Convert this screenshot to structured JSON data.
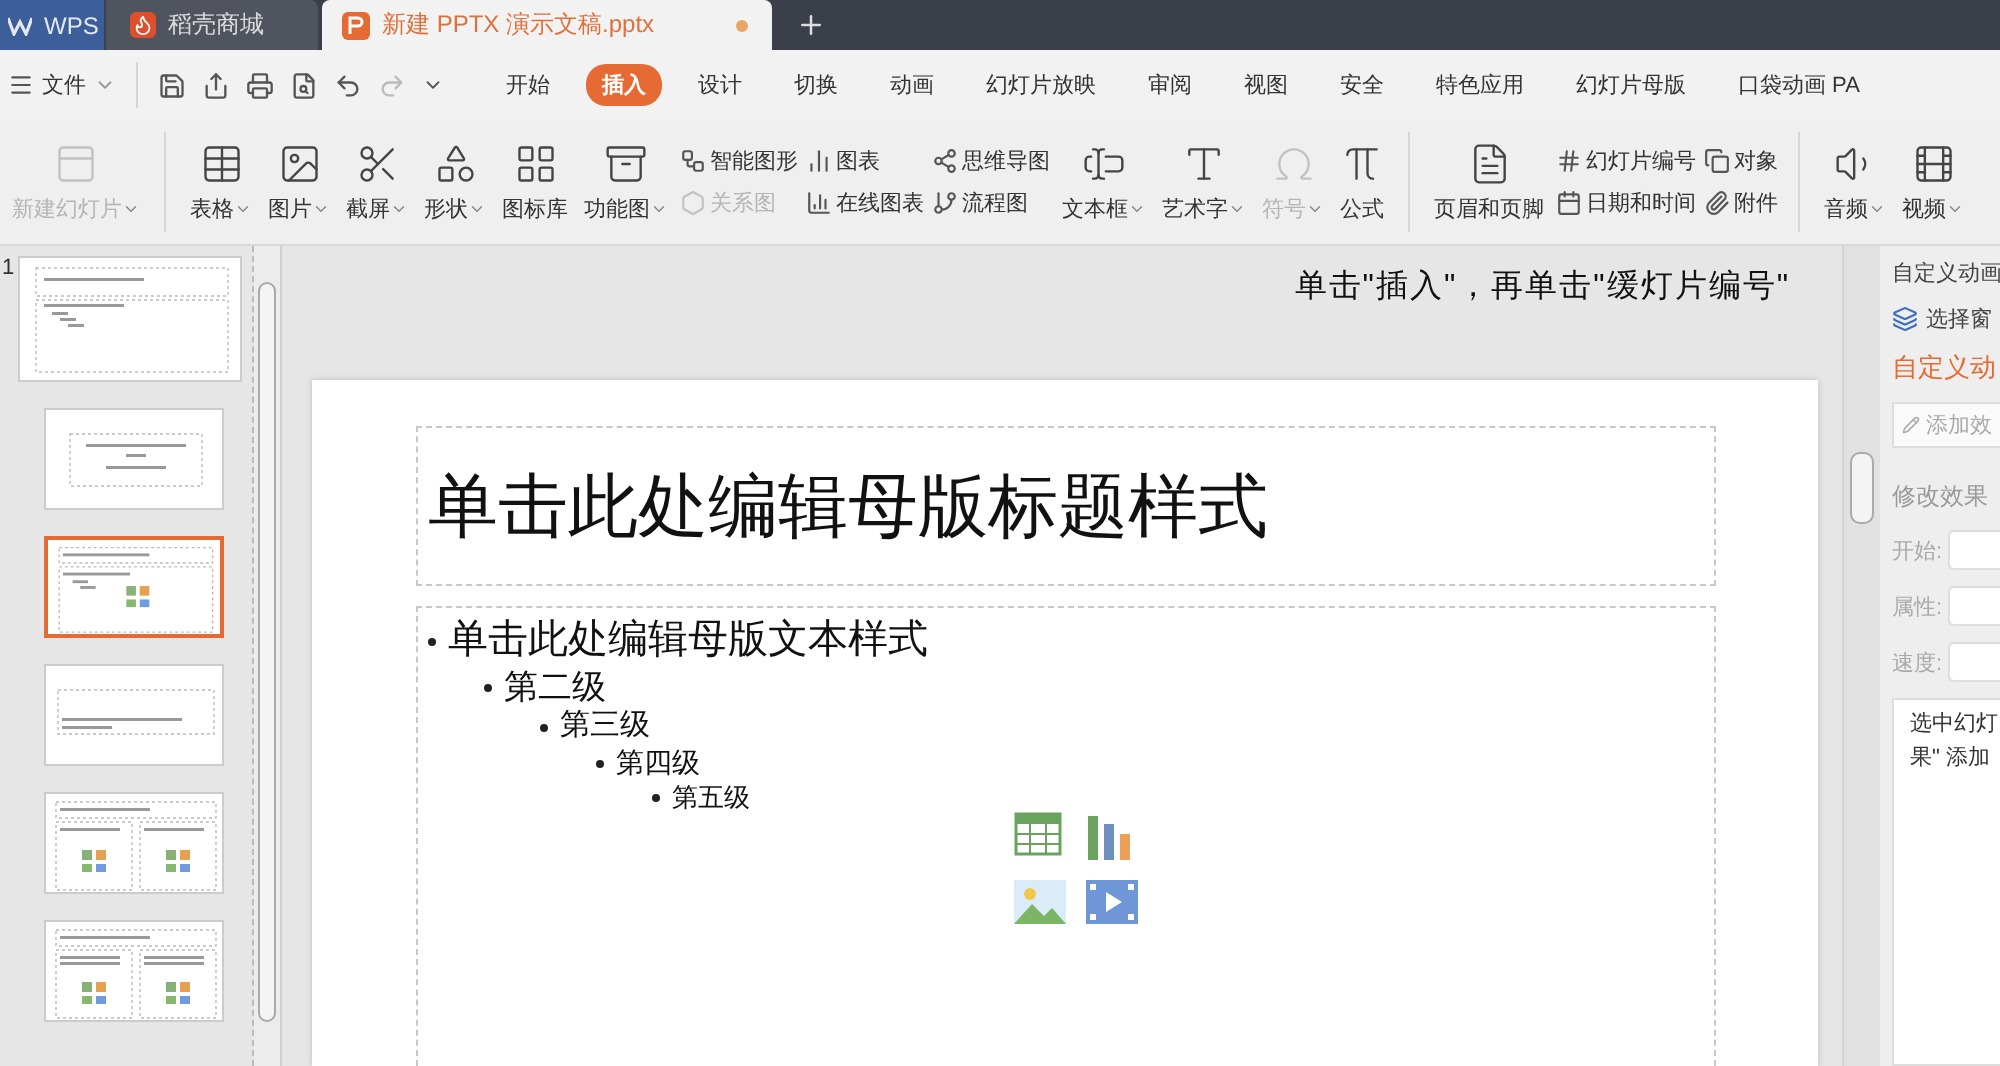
{
  "title_bar": {
    "tabs": [
      {
        "label": "WPS",
        "kind": "home",
        "selected": false
      },
      {
        "label": "稻壳商城",
        "kind": "store",
        "selected": false
      },
      {
        "label": "新建 PPTX 演示文稿.pptx",
        "kind": "doc",
        "selected": true
      }
    ]
  },
  "menu_bar": {
    "file_label": "文件",
    "tabs": [
      {
        "label": "开始",
        "selected": false
      },
      {
        "label": "插入",
        "selected": true
      },
      {
        "label": "设计",
        "selected": false
      },
      {
        "label": "切换",
        "selected": false
      },
      {
        "label": "动画",
        "selected": false
      },
      {
        "label": "幻灯片放映",
        "selected": false
      },
      {
        "label": "审阅",
        "selected": false
      },
      {
        "label": "视图",
        "selected": false
      },
      {
        "label": "安全",
        "selected": false
      },
      {
        "label": "特色应用",
        "selected": false
      },
      {
        "label": "幻灯片母版",
        "selected": false
      },
      {
        "label": "口袋动画 PA",
        "selected": false
      }
    ]
  },
  "ribbon_groups": [
    [
      {
        "kind": "large",
        "label": "新建幻灯片",
        "dropdown": true,
        "disabled": true
      }
    ],
    [
      {
        "kind": "large",
        "label": "表格",
        "dropdown": true,
        "disabled": false
      },
      {
        "kind": "large",
        "label": "图片",
        "dropdown": true,
        "disabled": false
      },
      {
        "kind": "large",
        "label": "截屏",
        "dropdown": true,
        "disabled": false
      },
      {
        "kind": "large",
        "label": "形状",
        "dropdown": true,
        "disabled": false
      },
      {
        "kind": "large",
        "label": "图标库",
        "dropdown": false,
        "disabled": false
      },
      {
        "kind": "large",
        "label": "功能图",
        "dropdown": true,
        "disabled": false
      },
      {
        "kind": "stack",
        "items": [
          {
            "label": "智能图形",
            "disabled": false
          },
          {
            "label": "关系图",
            "disabled": true
          }
        ]
      },
      {
        "kind": "stack",
        "items": [
          {
            "label": "图表",
            "disabled": false
          },
          {
            "label": "在线图表",
            "disabled": false
          }
        ]
      },
      {
        "kind": "stack",
        "items": [
          {
            "label": "思维导图",
            "disabled": false
          },
          {
            "label": "流程图",
            "disabled": false
          }
        ]
      },
      {
        "kind": "large",
        "label": "文本框",
        "dropdown": true,
        "disabled": false
      },
      {
        "kind": "large",
        "label": "艺术字",
        "dropdown": true,
        "disabled": false
      },
      {
        "kind": "large",
        "label": "符号",
        "dropdown": true,
        "disabled": true
      },
      {
        "kind": "large",
        "label": "公式",
        "dropdown": false,
        "disabled": false
      }
    ],
    [
      {
        "kind": "large",
        "label": "页眉和页脚",
        "dropdown": false,
        "disabled": false
      },
      {
        "kind": "stack",
        "items": [
          {
            "label": "幻灯片编号",
            "disabled": false
          },
          {
            "label": "日期和时间",
            "disabled": false
          }
        ]
      },
      {
        "kind": "stack",
        "items": [
          {
            "label": "对象",
            "disabled": false
          },
          {
            "label": "附件",
            "disabled": false
          }
        ]
      }
    ],
    [
      {
        "kind": "large",
        "label": "音频",
        "dropdown": true,
        "disabled": false
      },
      {
        "kind": "large",
        "label": "视频",
        "dropdown": true,
        "disabled": false
      }
    ]
  ],
  "thumbnails": [
    {
      "number": "1",
      "kind": "master",
      "selected": false
    },
    {
      "kind": "title",
      "selected": false
    },
    {
      "kind": "content",
      "selected": true
    },
    {
      "kind": "section",
      "selected": false
    },
    {
      "kind": "two",
      "selected": false
    },
    {
      "kind": "compare",
      "selected": false
    }
  ],
  "instruction": "单击\"插入\"，再单击\"缓灯片编号\"",
  "slide": {
    "title": "单击此处编辑母版标题样式",
    "bullets": [
      {
        "text": "单击此处编辑母版文本样式",
        "children": [
          {
            "text": "第二级",
            "children": [
              {
                "text": "第三级",
                "children": [
                  {
                    "text": "第四级",
                    "children": [
                      {
                        "text": "第五级"
                      }
                    ]
                  }
                ]
              }
            ]
          }
        ]
      }
    ]
  },
  "side_panel": {
    "header": "自定义动画",
    "select_label": "选择窗",
    "section_title": "自定义动",
    "add_button": {
      "label": "添加效",
      "disabled": true
    },
    "modify_title": "修改效果",
    "fields": [
      {
        "label": "开始:"
      },
      {
        "label": "属性:"
      },
      {
        "label": "速度:"
      }
    ],
    "hint_lines": [
      "选中幻灯",
      "果\" 添加"
    ]
  }
}
